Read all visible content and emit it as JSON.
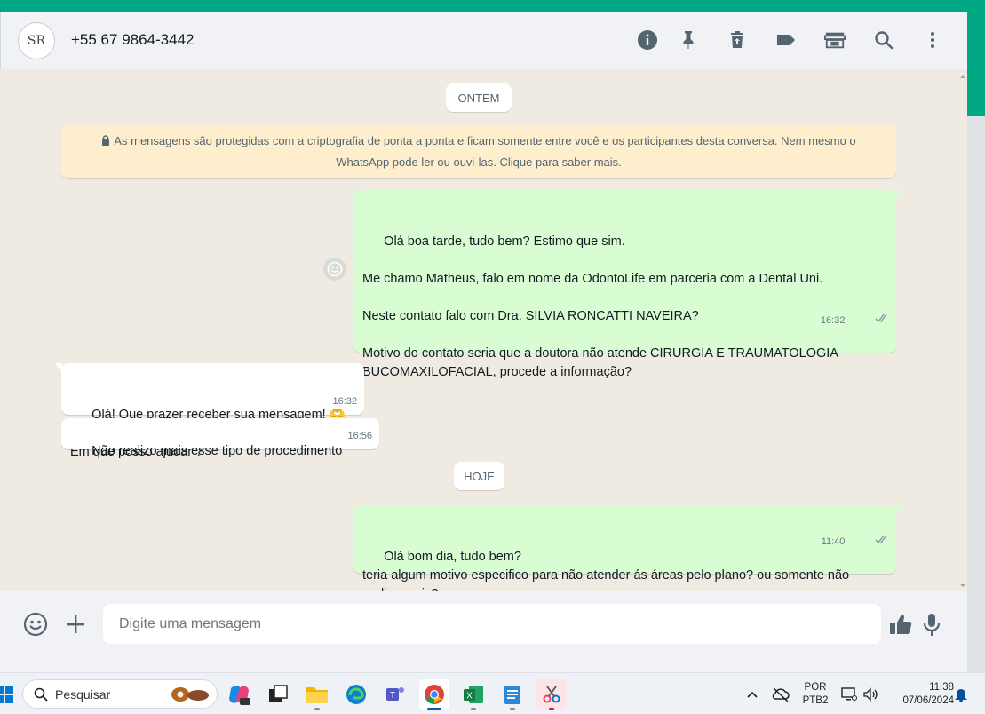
{
  "header": {
    "avatar_text": "SR",
    "contact": "+55 67 9864-3442"
  },
  "chat": {
    "date_yesterday": "ONTEM",
    "date_today": "HOJE",
    "encryption_notice": "As mensagens são protegidas com a criptografia de ponta a ponta e ficam somente entre você e os participantes desta conversa. Nem mesmo o WhatsApp pode ler ou ouvi-las. Clique para saber mais.",
    "messages": [
      {
        "direction": "out",
        "text": "Olá boa tarde, tudo bem? Estimo que sim.\n\nMe chamo Matheus, falo em nome da OdontoLife em parceria com a Dental Uni.\n\nNeste contato falo com Dra. SILVIA RONCATTI NAVEIRA?\n\nMotivo do contato seria que a doutora não atende CIRURGIA E TRAUMATOLOGIA BUCOMAXILOFACIAL, procede a informação?",
        "time": "16:32",
        "status": "read"
      },
      {
        "direction": "in",
        "text": "Olá! Que prazer receber sua mensagem! 🫶🦷\nEm que posso ajudar ?",
        "time": "16:32"
      },
      {
        "direction": "in",
        "text": "Não realizo mais esse tipo de procedimento",
        "time": "16:56"
      },
      {
        "direction": "out",
        "text": "Olá bom dia, tudo bem?\nteria algum motivo especifico para não atender ás áreas pelo plano? ou somente não realiza mais?",
        "time": "11:40",
        "status": "read"
      }
    ]
  },
  "composer": {
    "placeholder": "Digite uma mensagem"
  },
  "taskbar": {
    "search_placeholder": "Pesquisar",
    "language_line1": "POR",
    "language_line2": "PTB2",
    "time": "11:38",
    "date": "07/06/2024"
  },
  "colors": {
    "brand": "#00a884",
    "outgoing_bubble": "#d9fdd3",
    "incoming_bubble": "#ffffff",
    "chat_background": "#efeae2",
    "encryption_background": "#ffeecd"
  }
}
